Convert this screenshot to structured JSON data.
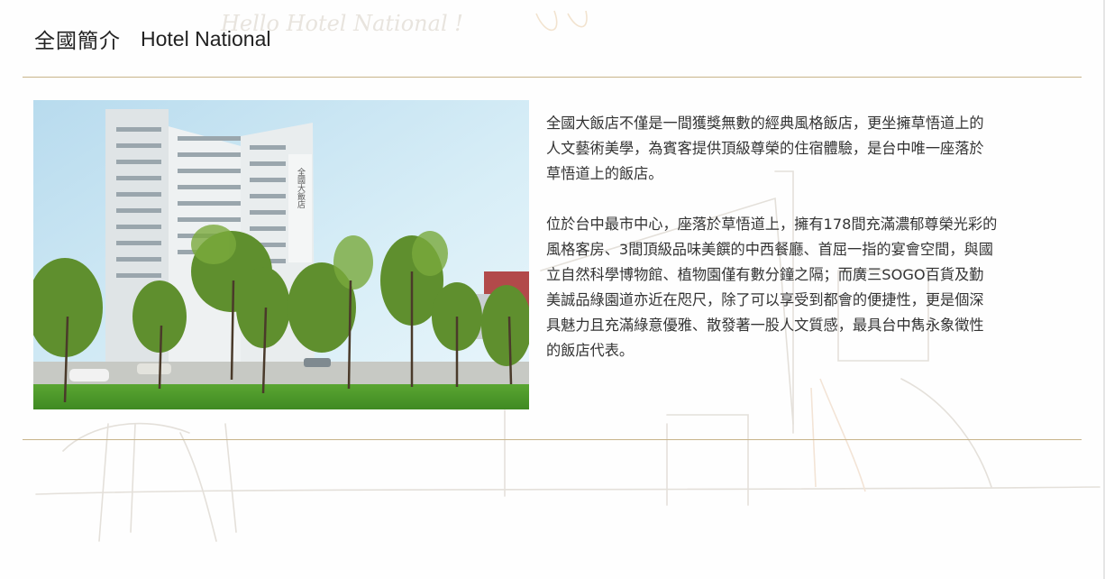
{
  "header": {
    "title_zh": "全國簡介",
    "title_en": "Hotel National"
  },
  "background": {
    "sketch_text": "Hello Hotel National !"
  },
  "photo": {
    "building_sign": "全國大飯店"
  },
  "content": {
    "paragraphs": [
      "全國大飯店不僅是一間獲獎無數的經典風格飯店，更坐擁草悟道上的\n人文藝術美學，為賓客提供頂級尊榮的住宿體驗，是台中唯一座落於\n草悟道上的飯店。",
      "位於台中最市中心，座落於草悟道上，擁有178間充滿濃郁尊榮光彩的\n風格客房、3間頂級品味美饌的中西餐廳、首屈一指的宴會空間，與國\n立自然科學博物館、植物園僅有數分鐘之隔；而廣三SOGO百貨及勤\n美誠品綠園道亦近在咫尺，除了可以享受到都會的便捷性，更是個深\n具魅力且充滿綠意優雅、散發著一股人文質感，最具台中雋永象徵性\n的飯店代表。"
    ]
  },
  "colors": {
    "rule": "#c8b48a",
    "text": "#333333",
    "sky_top": "#bfe0ef",
    "grass": "#4f9a2a"
  }
}
